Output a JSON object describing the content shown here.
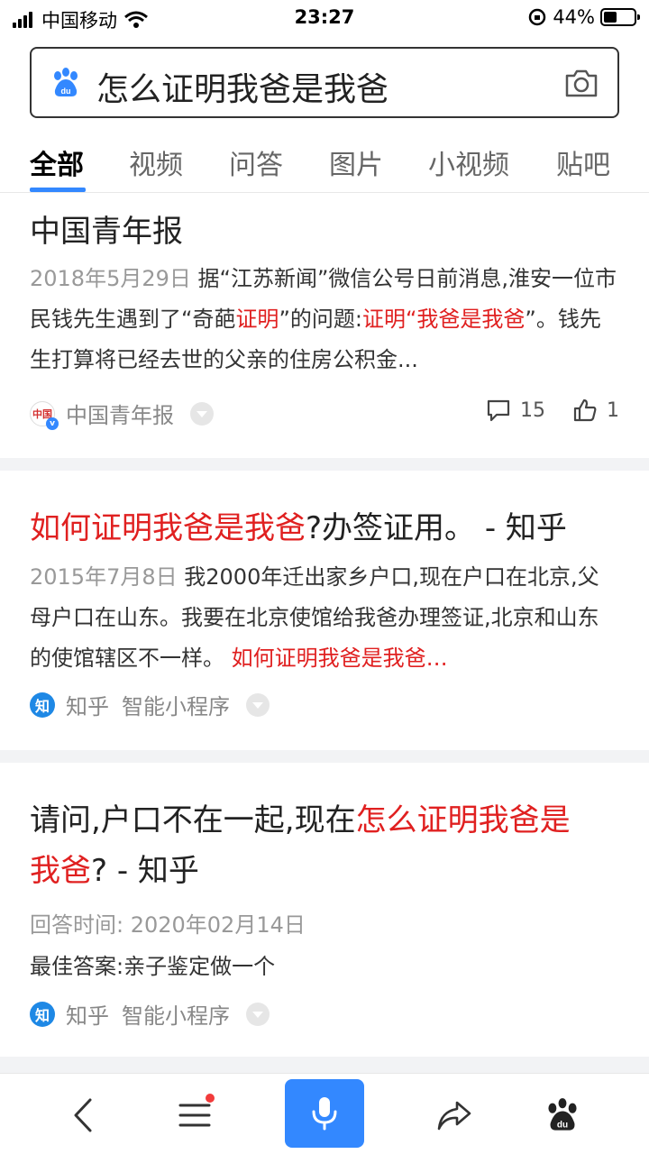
{
  "status": {
    "carrier": "中国移动",
    "time": "23:27",
    "battery_pct": "44%",
    "battery_level": 0.44
  },
  "search": {
    "query": "怎么证明我爸是我爸"
  },
  "tabs": [
    {
      "label": "全部",
      "active": true
    },
    {
      "label": "视频"
    },
    {
      "label": "问答"
    },
    {
      "label": "图片"
    },
    {
      "label": "小视频"
    },
    {
      "label": "贴吧"
    }
  ],
  "result1": {
    "title": "中国青年报",
    "date": "2018年5月29日",
    "snippet_a": "据“江苏新闻”微信公号日前消息,淮安一位市民钱先生遇到了“奇葩",
    "snippet_hl1": "证明",
    "snippet_b": "”的问题:",
    "snippet_hl2": "证明",
    "snippet_c": "“",
    "snippet_hl3": "我爸是我爸",
    "snippet_d": "”。钱先生打算将已经去世的父亲的住房公积金...",
    "source": "中国青年报",
    "source_logo_text": "中国",
    "comments": "15",
    "likes": "1"
  },
  "result2": {
    "title_hl": "如何证明我爸是我爸",
    "title_rest": "?办签证用。 - 知乎",
    "date": "2015年7月8日",
    "snippet": "我2000年迁出家乡户口,现在户口在北京,父母户口在山东。我要在北京使馆给我爸办理签证,北京和山东的使馆辖区不一样。",
    "snippet_hl": "如何证明我爸是我爸…",
    "source": "知乎",
    "source_icon_text": "知",
    "mini_program": "智能小程序"
  },
  "result3": {
    "title_a": "请问,户口不在一起,现在",
    "title_hl_a": "怎么证明我爸是",
    "title_hl_b": "我爸",
    "title_b": "? - 知乎",
    "answer_time": "回答时间: 2020年02月14日",
    "best_answer": "最佳答案:亲子鉴定做一个",
    "source": "知乎",
    "source_icon_text": "知",
    "mini_program": "智能小程序"
  },
  "icons": {
    "brand": "baidu-paw-icon",
    "camera": "camera-icon",
    "back": "back-arrow-icon",
    "menu": "menu-icon",
    "mic": "microphone-icon",
    "share": "share-icon",
    "home": "baidu-home-icon"
  },
  "colors": {
    "accent": "#3388ff",
    "highlight": "#e02020"
  }
}
